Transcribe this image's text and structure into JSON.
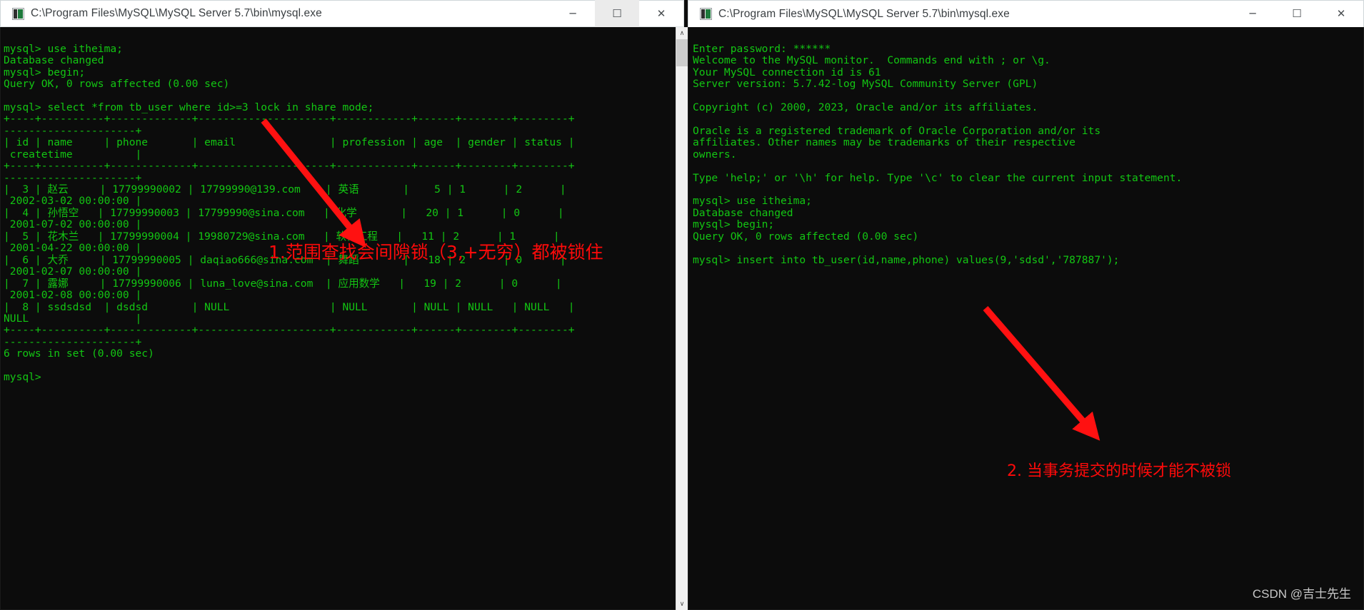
{
  "windows": [
    {
      "id": "left",
      "title": "C:\\Program Files\\MySQL\\MySQL Server 5.7\\bin\\mysql.exe",
      "icon": "console-app-icon",
      "buttons": {
        "minimize": "─",
        "maximize": "☐",
        "close": "✕"
      },
      "terminal_text": "mysql> use itheima;\nDatabase changed\nmysql> begin;\nQuery OK, 0 rows affected (0.00 sec)\n\nmysql> select *from tb_user where id>=3 lock in share mode;\n+----+----------+-------------+---------------------+------------+------+--------+--------+\n---------------------+\n| id | name     | phone       | email               | profession | age  | gender | status |\n createtime          |\n+----+----------+-------------+---------------------+------------+------+--------+--------+\n---------------------+\n|  3 | 赵云     | 17799990002 | 17799990@139.com    | 英语       |    5 | 1      | 2      |\n 2002-03-02 00:00:00 |\n|  4 | 孙悟空   | 17799990003 | 17799990@sina.com   | 化学       |   20 | 1      | 0      |\n 2001-07-02 00:00:00 |\n|  5 | 花木兰   | 17799990004 | 19980729@sina.com   | 软件工程   |   11 | 2      | 1      |\n 2001-04-22 00:00:00 |\n|  6 | 大乔     | 17799990005 | daqiao666@sina.com  | 舞蹈       |   18 | 2      | 0      |\n 2001-02-07 00:00:00 |\n|  7 | 露娜     | 17799990006 | luna_love@sina.com  | 应用数学   |   19 | 2      | 0      |\n 2001-02-08 00:00:00 |\n|  8 | ssdsdsd  | dsdsd       | NULL                | NULL       | NULL | NULL   | NULL   |\nNULL                 |\n+----+----------+-------------+---------------------+------------+------+--------+--------+\n---------------------+\n6 rows in set (0.00 sec)\n\nmysql>"
    },
    {
      "id": "right",
      "title": "C:\\Program Files\\MySQL\\MySQL Server 5.7\\bin\\mysql.exe",
      "icon": "console-app-icon",
      "buttons": {
        "minimize": "─",
        "maximize": "☐",
        "close": "✕"
      },
      "terminal_text": "Enter password: ******\nWelcome to the MySQL monitor.  Commands end with ; or \\g.\nYour MySQL connection id is 61\nServer version: 5.7.42-log MySQL Community Server (GPL)\n\nCopyright (c) 2000, 2023, Oracle and/or its affiliates.\n\nOracle is a registered trademark of Oracle Corporation and/or its\naffiliates. Other names may be trademarks of their respective\nowners.\n\nType 'help;' or '\\h' for help. Type '\\c' to clear the current input statement.\n\nmysql> use itheima;\nDatabase changed\nmysql> begin;\nQuery OK, 0 rows affected (0.00 sec)\n\nmysql> insert into tb_user(id,name,phone) values(9,'sdsd','787887');"
    }
  ],
  "annotations": [
    {
      "id": "anno-1",
      "text": "1.范围查找会间隙锁（3,+无穷）都被锁住",
      "color": "#ff0a0a"
    },
    {
      "id": "anno-2",
      "text": "2. 当事务提交的时候才能不被锁",
      "color": "#ff0a0a"
    }
  ],
  "watermark": {
    "text": "CSDN @吉士先生"
  },
  "scrollbar": {
    "up_arrow": "∧",
    "down_arrow": "∨"
  },
  "colors": {
    "terminal_bg": "#0c0c0c",
    "terminal_fg": "#13c613",
    "annotation_red": "#ff0a0a",
    "titlebar_bg": "#ffffff",
    "titlebar_fg": "#3a3f42"
  }
}
